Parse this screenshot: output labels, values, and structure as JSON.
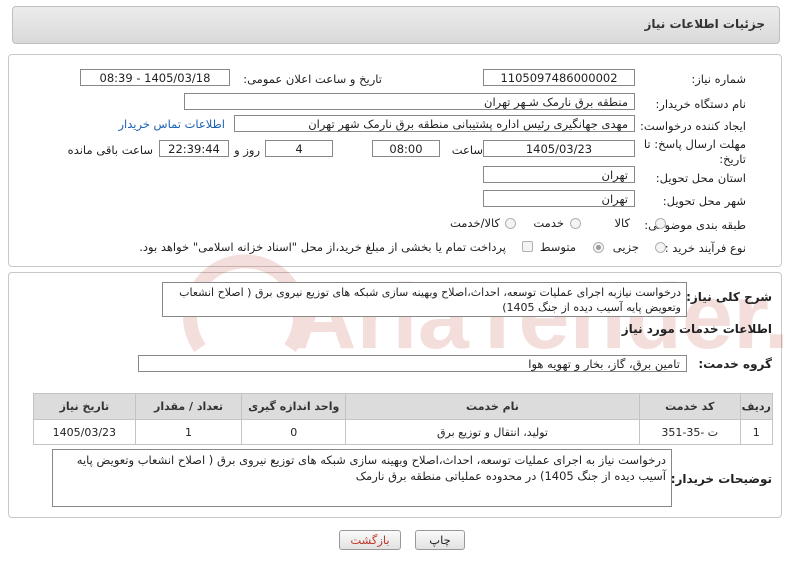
{
  "header": {
    "title": "جزئیات اطلاعات نیاز"
  },
  "form": {
    "need_number_label": "شماره نیاز:",
    "need_number": "1105097486000002",
    "announce_label": "تاریخ و ساعت اعلان عمومی:",
    "announce_value": "1405/03/18 - 08:39",
    "buyer_org_label": "نام دستگاه خریدار:",
    "buyer_org": "منطقه برق نارمک شـهر تهران",
    "creator_label": "ایجاد کننده درخواست:",
    "creator": "مهدی جهانگیری رئیس اداره پشتیبانی  منطقه برق نارمک شهر تهران",
    "contact_link": "اطلاعات تماس خریدار",
    "deadline_label_1": "مهلت ارسال پاسخ: تا",
    "deadline_label_2": "تاریخ:",
    "deadline_date": "1405/03/23",
    "time_label": "ساعت",
    "deadline_time": "08:00",
    "days_value": "4",
    "days_label": "روز و",
    "remaining_value": "22:39:44",
    "remaining_label": "ساعت باقی مانده",
    "province_label": "استان محل تحویل:",
    "province": "تهران",
    "city_label": "شهر محل تحویل:",
    "city": "تهران",
    "category_label": "طبقه بندی موضوعی:",
    "category_options": [
      "کالا",
      "خدمت",
      "کالا/خدمت"
    ],
    "process_label": "نوع فرآیند خرید :",
    "process_options": [
      "جزیی",
      "متوسط"
    ],
    "payment_note": "پرداخت تمام یا بخشی از مبلغ خرید،از محل \"اسناد خزانه اسلامی\" خواهد بود."
  },
  "description": {
    "label": "شرح کلی نیاز:",
    "text": "درخواست نیازبه اجرای عملیات توسعه، احداث،اصلاح وبهینه سازی شبکه های توزیع نیروی برق ( اصلاح انشعاب وتعویض پایه آسیب دیده از جنگ 1405)"
  },
  "services": {
    "section_title": "اطلاعات خدمات مورد نیاز",
    "group_label": "گروه خدمت:",
    "group_value": "تامین برق، گاز، بخار و تهویه هوا",
    "table": {
      "headers": [
        "ردیف",
        "کد خدمت",
        "نام خدمت",
        "واحد اندازه گیری",
        "تعداد / مقدار",
        "تاریخ نیاز"
      ],
      "rows": [
        {
          "row": "1",
          "code": "ت -35-351",
          "name": "تولید، انتقال و توزیع برق",
          "unit": "0",
          "qty": "1",
          "date": "1405/03/23"
        }
      ]
    }
  },
  "buyer_notes": {
    "label": "توضیحات خریدار:",
    "text": "درخواست نیاز به اجرای عملیات توسعه، احداث،اصلاح وبهینه سازی شبکه های توزیع نیروی برق ( اصلاح انشعاب وتعویض پایه آسیب دیده از جنگ 1405) در محدوده عملیاتی منطقه برق نارمک"
  },
  "buttons": {
    "print": "چاپ",
    "back": "بازگشت"
  },
  "watermark": {
    "text": "AriaTender.neT"
  },
  "colors": {
    "link": "#1a5fb4",
    "back_button_text": "#c0392b",
    "watermark": "#c0392b"
  }
}
